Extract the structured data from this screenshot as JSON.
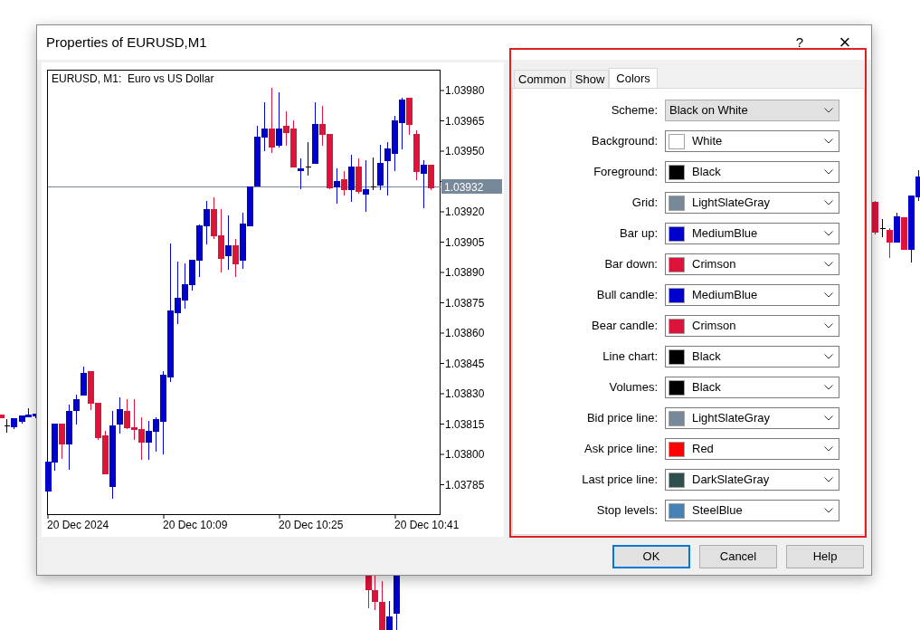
{
  "window": {
    "title": "Properties of EURUSD,M1",
    "help_button": "?",
    "close_button": "×"
  },
  "chart": {
    "title": "EURUSD, M1:  Euro vs US Dollar",
    "current_price": "1.03932",
    "price_labels": [
      "1.03980",
      "1.03965",
      "1.03950",
      "1.03920",
      "1.03905",
      "1.03890",
      "1.03875",
      "1.03860",
      "1.03845",
      "1.03830",
      "1.03815",
      "1.03800",
      "1.03785"
    ],
    "time_labels": [
      "20 Dec 2024",
      "20 Dec 10:09",
      "20 Dec 10:25",
      "20 Dec 10:41"
    ]
  },
  "tabs": [
    {
      "label": "Common",
      "selected": false
    },
    {
      "label": "Show",
      "selected": false
    },
    {
      "label": "Colors",
      "selected": true
    }
  ],
  "scheme": {
    "label": "Scheme:",
    "value": "Black on White"
  },
  "color_rows": [
    {
      "label": "Background:",
      "value": "White",
      "color": "#ffffff"
    },
    {
      "label": "Foreground:",
      "value": "Black",
      "color": "#000000"
    },
    {
      "label": "Grid:",
      "value": "LightSlateGray",
      "color": "#778899"
    },
    {
      "label": "Bar up:",
      "value": "MediumBlue",
      "color": "#0000cd"
    },
    {
      "label": "Bar down:",
      "value": "Crimson",
      "color": "#dc143c"
    },
    {
      "label": "Bull candle:",
      "value": "MediumBlue",
      "color": "#0000cd"
    },
    {
      "label": "Bear candle:",
      "value": "Crimson",
      "color": "#dc143c"
    },
    {
      "label": "Line chart:",
      "value": "Black",
      "color": "#000000"
    },
    {
      "label": "Volumes:",
      "value": "Black",
      "color": "#000000"
    },
    {
      "label": "Bid price line:",
      "value": "LightSlateGray",
      "color": "#778899"
    },
    {
      "label": "Ask price line:",
      "value": "Red",
      "color": "#ff0000"
    },
    {
      "label": "Last price line:",
      "value": "DarkSlateGray",
      "color": "#2f4f4f"
    },
    {
      "label": "Stop levels:",
      "value": "SteelBlue",
      "color": "#4682b4"
    }
  ],
  "buttons": [
    {
      "label": "OK",
      "default": true
    },
    {
      "label": "Cancel",
      "default": false
    },
    {
      "label": "Help",
      "default": false
    }
  ]
}
